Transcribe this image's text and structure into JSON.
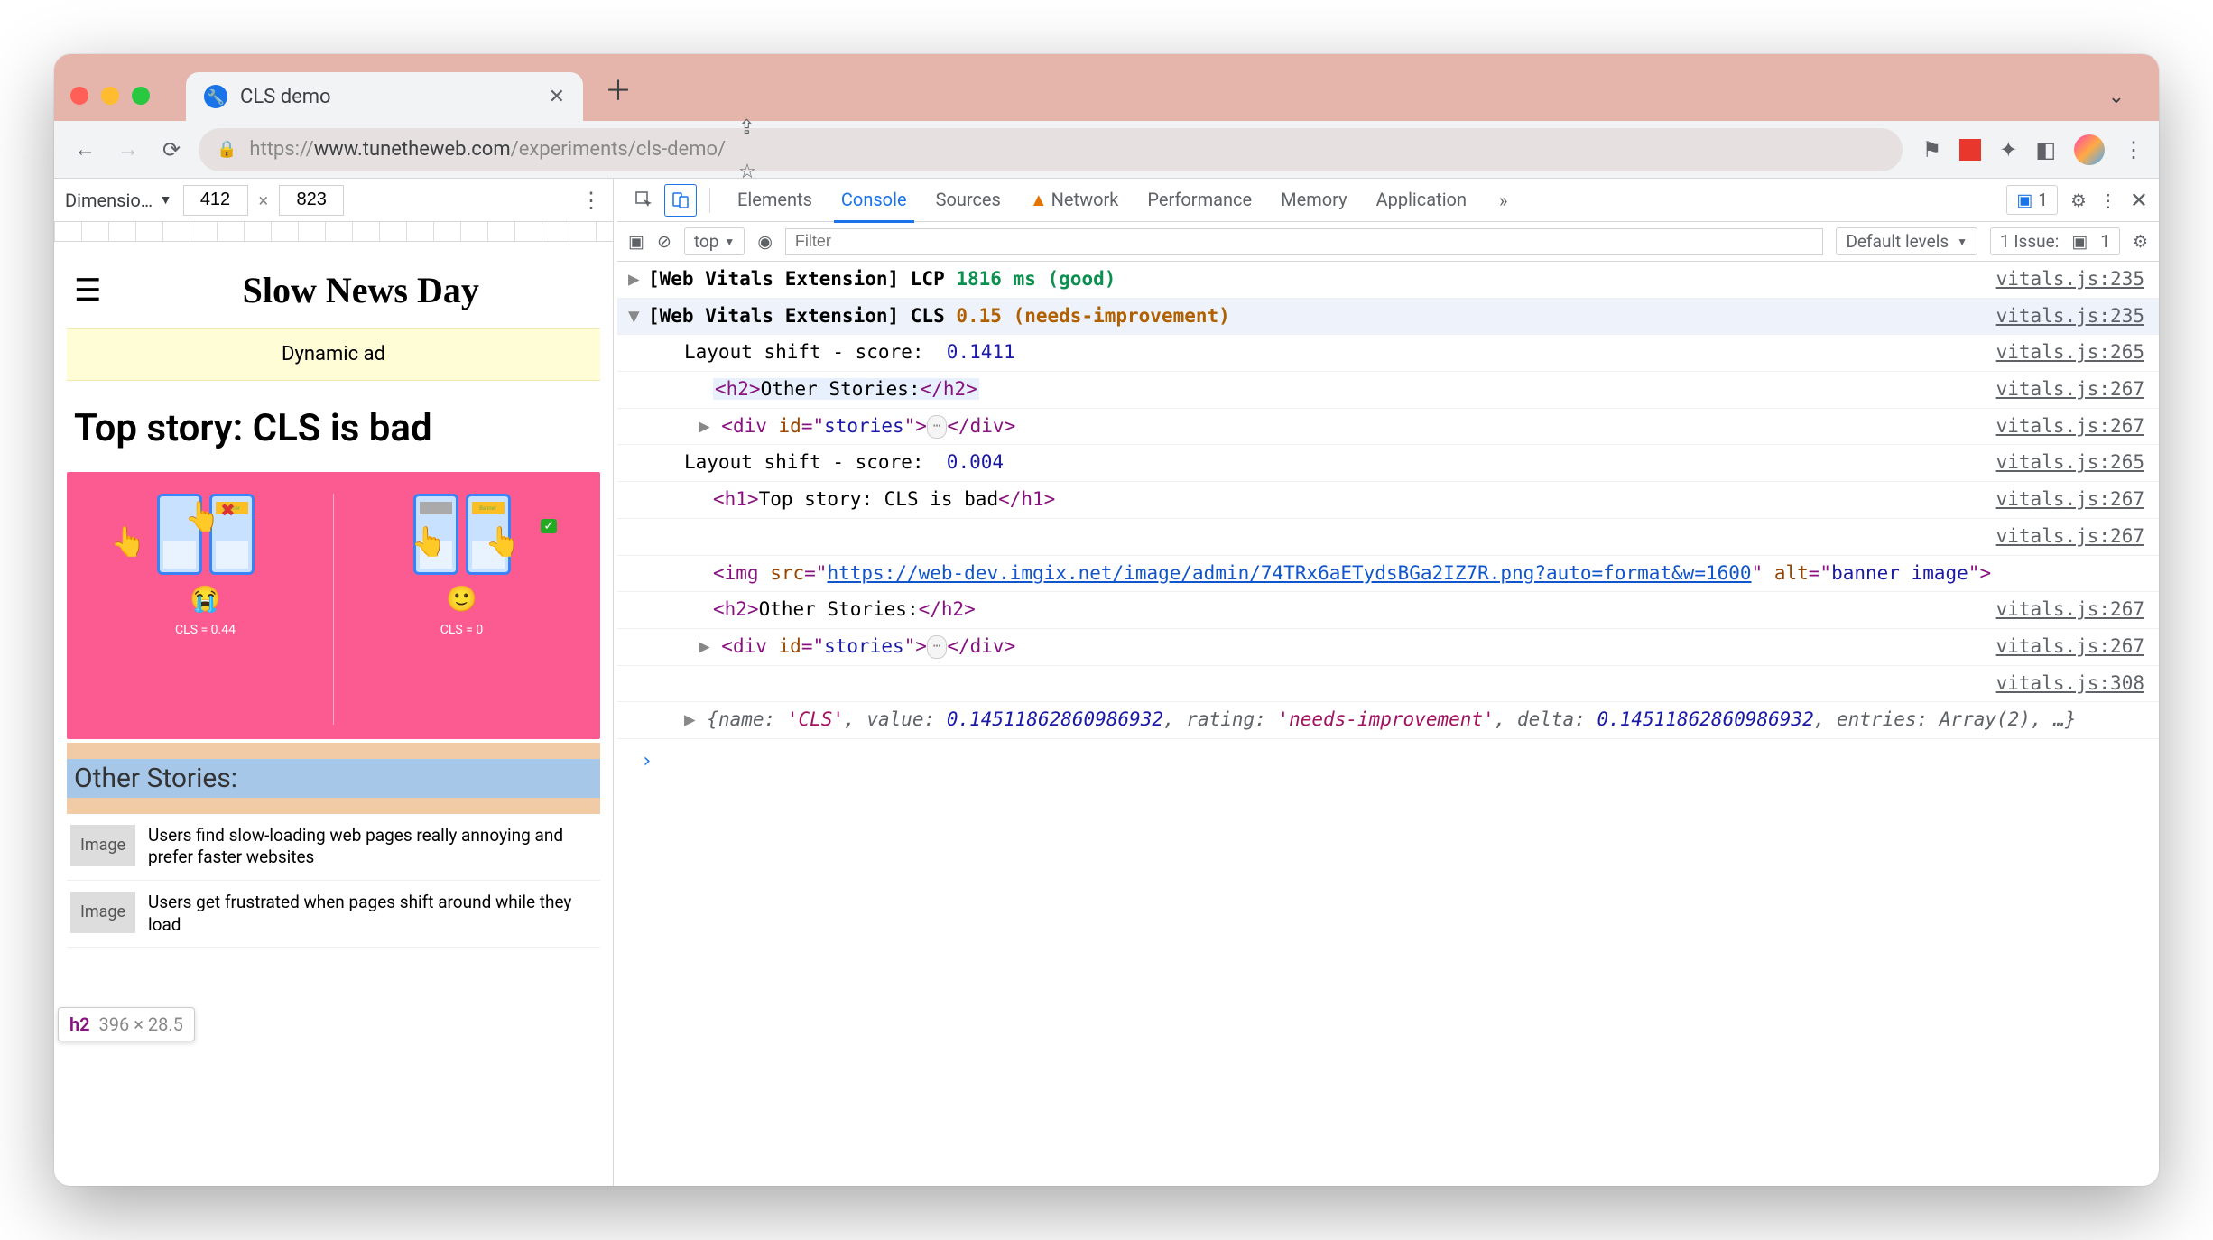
{
  "tab": {
    "title": "CLS demo"
  },
  "url": {
    "scheme": "https://",
    "host": "www.tunetheweb.com",
    "path": "/experiments/cls-demo/"
  },
  "device_bar": {
    "label": "Dimensio…",
    "width": "412",
    "height": "823"
  },
  "page": {
    "site_title": "Slow News Day",
    "ad_text": "Dynamic ad",
    "top_story": "Top story: CLS is bad",
    "other_stories_heading": "Other Stories:",
    "cls_label_bad": "CLS = 0.44",
    "cls_label_good": "CLS = 0",
    "stories": [
      {
        "img": "Image",
        "text": "Users find slow-loading web pages really annoying and prefer faster websites"
      },
      {
        "img": "Image",
        "text": "Users get frustrated when pages shift around while they load"
      }
    ],
    "tooltip": {
      "tag": "h2",
      "dims": "396 × 28.5"
    }
  },
  "devtools": {
    "tabs": [
      "Elements",
      "Console",
      "Sources",
      "Network",
      "Performance",
      "Memory",
      "Application"
    ],
    "active_tab": "Console",
    "chatter_count": "1",
    "issues_label": "1 Issue:",
    "issues_count": "1",
    "console_bar": {
      "context": "top",
      "filter_placeholder": "Filter",
      "levels": "Default levels"
    },
    "rows": [
      {
        "kind": "collapsed",
        "text_parts": [
          {
            "t": "[Web Vitals Extension] LCP ",
            "c": ""
          },
          {
            "t": "1816 ms (good)",
            "c": "token-good"
          }
        ],
        "src": "vitals.js:235"
      },
      {
        "kind": "expanded",
        "text_parts": [
          {
            "t": "[Web Vitals Extension] CLS ",
            "c": ""
          },
          {
            "t": "0.15 (needs-improvement)",
            "c": "token-warn"
          }
        ],
        "src": "vitals.js:235"
      },
      {
        "kind": "child",
        "text_parts": [
          {
            "t": "Layout shift - score:  ",
            "c": ""
          },
          {
            "t": "0.1411",
            "c": "token-num"
          }
        ],
        "src": "vitals.js:265"
      },
      {
        "kind": "child2_hl",
        "text_parts": [
          {
            "t": "<h2>",
            "c": "token-tag"
          },
          {
            "t": "Other Stories:",
            "c": ""
          },
          {
            "t": "</h2>",
            "c": "token-tag"
          }
        ],
        "src": "vitals.js:267"
      },
      {
        "kind": "child2b_expand",
        "text_parts": [
          {
            "t": "<div ",
            "c": "token-tag"
          },
          {
            "t": "id",
            "c": "token-attr"
          },
          {
            "t": "=\"",
            "c": "token-tag"
          },
          {
            "t": "stories",
            "c": "token-str"
          },
          {
            "t": "\">",
            "c": "token-tag"
          },
          {
            "t": "…",
            "c": "ellipsis"
          },
          {
            "t": "</div>",
            "c": "token-tag"
          }
        ],
        "src": "vitals.js:267"
      },
      {
        "kind": "child",
        "text_parts": [
          {
            "t": "Layout shift - score:  ",
            "c": ""
          },
          {
            "t": "0.004",
            "c": "token-num"
          }
        ],
        "src": "vitals.js:265"
      },
      {
        "kind": "child2",
        "text_parts": [
          {
            "t": "<h1>",
            "c": "token-tag"
          },
          {
            "t": "Top story: CLS is bad",
            "c": ""
          },
          {
            "t": "</h1>",
            "c": "token-tag"
          }
        ],
        "src": "vitals.js:267"
      },
      {
        "kind": "srconly",
        "src": "vitals.js:267"
      },
      {
        "kind": "child2_wrap",
        "text_parts": [
          {
            "t": "<img ",
            "c": "token-tag"
          },
          {
            "t": "src",
            "c": "token-attr"
          },
          {
            "t": "=\"",
            "c": "token-tag"
          },
          {
            "t": "https://web-dev.imgix.net/image/admin/74TRx6aETydsBGa2IZ7R.png?auto=format&w=1600",
            "c": "token-link"
          },
          {
            "t": "\" ",
            "c": "token-tag"
          },
          {
            "t": "alt",
            "c": "token-attr"
          },
          {
            "t": "=\"",
            "c": "token-tag"
          },
          {
            "t": "banner image",
            "c": "token-str"
          },
          {
            "t": "\">",
            "c": "token-tag"
          }
        ]
      },
      {
        "kind": "child2",
        "text_parts": [
          {
            "t": "<h2>",
            "c": "token-tag"
          },
          {
            "t": "Other Stories:",
            "c": ""
          },
          {
            "t": "</h2>",
            "c": "token-tag"
          }
        ],
        "src": "vitals.js:267"
      },
      {
        "kind": "child2b_expand",
        "text_parts": [
          {
            "t": "<div ",
            "c": "token-tag"
          },
          {
            "t": "id",
            "c": "token-attr"
          },
          {
            "t": "=\"",
            "c": "token-tag"
          },
          {
            "t": "stories",
            "c": "token-str"
          },
          {
            "t": "\">",
            "c": "token-tag"
          },
          {
            "t": "…",
            "c": "ellipsis"
          },
          {
            "t": "</div>",
            "c": "token-tag"
          }
        ],
        "src": "vitals.js:267"
      },
      {
        "kind": "srconly",
        "src": "vitals.js:308"
      },
      {
        "kind": "child_obj",
        "text_parts": [
          {
            "t": "{",
            "c": "token-obj"
          },
          {
            "t": "name: ",
            "c": "token-obj"
          },
          {
            "t": "'CLS'",
            "c": "token-name"
          },
          {
            "t": ", value: ",
            "c": "token-obj"
          },
          {
            "t": "0.14511862860986932",
            "c": "token-val"
          },
          {
            "t": ", rating: ",
            "c": "token-obj"
          },
          {
            "t": "'needs-improvement'",
            "c": "token-name"
          },
          {
            "t": ", delta: ",
            "c": "token-obj"
          },
          {
            "t": "0.14511862860986932",
            "c": "token-val"
          },
          {
            "t": ", entries: Array(2), …}",
            "c": "token-obj"
          }
        ]
      }
    ]
  }
}
